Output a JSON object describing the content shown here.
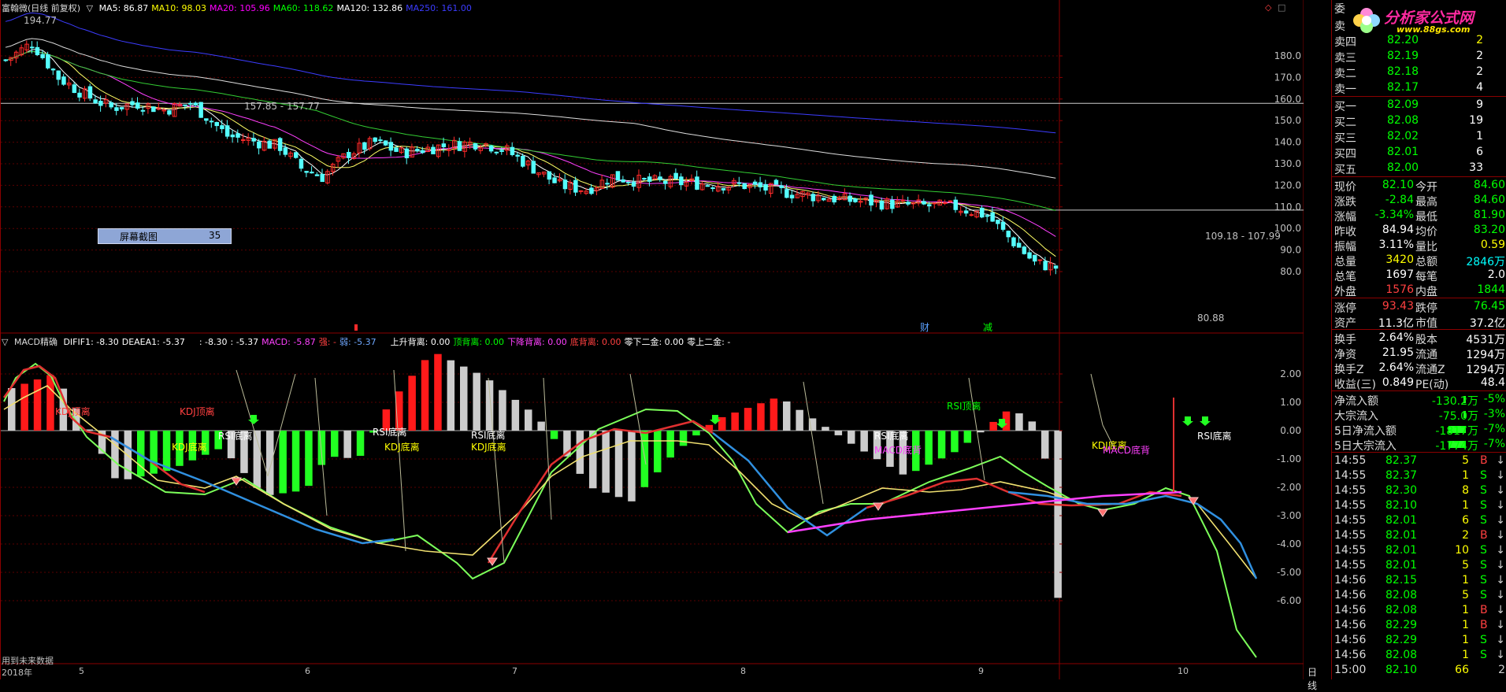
{
  "main_header": {
    "title": "富翰微(日线 前复权)",
    "ma_labels": [
      {
        "text": "MA5: 86.87",
        "color": "#ffffff"
      },
      {
        "text": "MA10: 98.03",
        "color": "#ffff00"
      },
      {
        "text": "MA20: 105.96",
        "color": "#ff00ff"
      },
      {
        "text": "MA60: 118.62",
        "color": "#00ff00"
      },
      {
        "text": "MA120: 132.86",
        "color": "#ffffff"
      },
      {
        "text": "MA250: 161.00",
        "color": "#3c3cff"
      }
    ]
  },
  "price_axis": [
    "180.0",
    "170.0",
    "160.0",
    "150.0",
    "140.0",
    "130.0",
    "120.0",
    "110.0",
    "100.0",
    "90.0",
    "80.0"
  ],
  "price_annotations": {
    "high": "194.77",
    "level1": "157.85 - 157.77",
    "level2": "109.18 - 107.99",
    "low": "80.88"
  },
  "event_markers": [
    {
      "text": "财",
      "color": "#5aa0ff"
    },
    {
      "text": "减",
      "color": "#00ff00"
    }
  ],
  "screenshot_badge": {
    "label": "屏幕截图",
    "value": "35"
  },
  "macd_header": {
    "title": "MACD精确",
    "items": [
      {
        "text": "DIFIF1: -8.30",
        "color": "#ffffff"
      },
      {
        "text": "DEAEA1: -5.37",
        "color": "#ffffff"
      },
      {
        "text": ": -8.30",
        "color": "#ffffff"
      },
      {
        "text": ": -5.37",
        "color": "#ffffff"
      },
      {
        "text": "MACD: -5.87",
        "color": "#ff40ff"
      },
      {
        "text": "强: -",
        "color": "#ff4040"
      },
      {
        "text": "弱: -5.37",
        "color": "#6fa8ff"
      },
      {
        "text": "上升背离: 0.00",
        "color": "#ffffff"
      },
      {
        "text": "顶背离: 0.00",
        "color": "#00ff00"
      },
      {
        "text": "下降背离: 0.00",
        "color": "#ff40ff"
      },
      {
        "text": "底背离: 0.00",
        "color": "#ff4040"
      },
      {
        "text": "零下二金: 0.00",
        "color": "#ffffff"
      },
      {
        "text": "零上二金: -",
        "color": "#ffffff"
      }
    ]
  },
  "macd_axis": [
    "2.00",
    "1.00",
    "0.00",
    "-1.00",
    "-2.00",
    "-3.00",
    "-4.00",
    "-5.00",
    "-6.00"
  ],
  "macd_annotations": [
    {
      "text": "KDJ顶离",
      "color": "#ff4040"
    },
    {
      "text": "KDJ顶离",
      "color": "#ff4040"
    },
    {
      "text": "KDJ底离",
      "color": "#ffff00"
    },
    {
      "text": "RSI底离",
      "color": "#ffffff"
    },
    {
      "text": "RSI底离",
      "color": "#ffffff"
    },
    {
      "text": "KDJ底离",
      "color": "#ffff00"
    },
    {
      "text": "RSI底离",
      "color": "#ffffff"
    },
    {
      "text": "KDJ底离",
      "color": "#ffff00"
    },
    {
      "text": "RSI顶离",
      "color": "#00ff00"
    },
    {
      "text": "RSI底离",
      "color": "#ffffff"
    },
    {
      "text": "MACD底背",
      "color": "#ff40ff"
    },
    {
      "text": "KDJ底离",
      "color": "#ffff00"
    },
    {
      "text": "MACD底背",
      "color": "#ff40ff"
    },
    {
      "text": "RSI底离",
      "color": "#ffffff"
    }
  ],
  "footer_note": "用到未来数据",
  "x_axis": {
    "labels": [
      "2018年",
      "5",
      "6",
      "7",
      "8",
      "9",
      "10"
    ],
    "period": "日线"
  },
  "quote": {
    "sell_header": "委",
    "sell_partial": [
      {
        "label": "卖",
        "price": "",
        "vol": ""
      },
      {
        "label": "卖四",
        "price": "82.20",
        "vol": "2"
      }
    ],
    "sell": [
      {
        "label": "卖三",
        "price": "82.19",
        "vol": "2"
      },
      {
        "label": "卖二",
        "price": "82.18",
        "vol": "2"
      },
      {
        "label": "卖一",
        "price": "82.17",
        "vol": "4"
      }
    ],
    "buy": [
      {
        "label": "买一",
        "price": "82.09",
        "vol": "9"
      },
      {
        "label": "买二",
        "price": "82.08",
        "vol": "19"
      },
      {
        "label": "买三",
        "price": "82.02",
        "vol": "1"
      },
      {
        "label": "买四",
        "price": "82.01",
        "vol": "6"
      },
      {
        "label": "买五",
        "price": "82.00",
        "vol": "33"
      }
    ],
    "stats": [
      {
        "l1": "现价",
        "v1": "82.10",
        "c1": "#00ff00",
        "l2": "今开",
        "v2": "84.60",
        "c2": "#00ff00"
      },
      {
        "l1": "涨跌",
        "v1": "-2.84",
        "c1": "#00ff00",
        "l2": "最高",
        "v2": "84.60",
        "c2": "#00ff00"
      },
      {
        "l1": "涨幅",
        "v1": "-3.34%",
        "c1": "#00ff00",
        "l2": "最低",
        "v2": "81.90",
        "c2": "#00ff00"
      },
      {
        "l1": "昨收",
        "v1": "84.94",
        "c1": "#ffffff",
        "l2": "均价",
        "v2": "83.20",
        "c2": "#00ff00"
      },
      {
        "l1": "振幅",
        "v1": "3.11%",
        "c1": "#ffffff",
        "l2": "量比",
        "v2": "0.59",
        "c2": "#ffff00"
      },
      {
        "l1": "总量",
        "v1": "3420",
        "c1": "#ffff00",
        "l2": "总额",
        "v2": "2846万",
        "c2": "#00ffff"
      },
      {
        "l1": "总笔",
        "v1": "1697",
        "c1": "#ffffff",
        "l2": "每笔",
        "v2": "2.0",
        "c2": "#ffffff"
      },
      {
        "l1": "外盘",
        "v1": "1576",
        "c1": "#ff4040",
        "l2": "内盘",
        "v2": "1844",
        "c2": "#00ff00"
      }
    ],
    "limits": [
      {
        "l1": "涨停",
        "v1": "93.43",
        "c1": "#ff4040",
        "l2": "跌停",
        "v2": "76.45",
        "c2": "#00ff00"
      },
      {
        "l1": "资产",
        "v1": "11.3亿",
        "c1": "#ffffff",
        "l2": "市值",
        "v2": "37.2亿",
        "c2": "#ffffff"
      }
    ],
    "finance": [
      {
        "l1": "换手",
        "v1": "2.64%",
        "l2": "股本",
        "v2": "4531万"
      },
      {
        "l1": "净资",
        "v1": "21.95",
        "l2": "流通",
        "v2": "1294万"
      },
      {
        "l1": "换手Z",
        "v1": "2.64%",
        "l2": "流通Z",
        "v2": "1294万"
      },
      {
        "l1": "收益(三)",
        "v1": "0.849",
        "l2": "PE(动)",
        "v2": "48.4"
      }
    ],
    "flows": [
      {
        "label": "净流入额",
        "val": "-130.2万",
        "pct": "-5%"
      },
      {
        "label": "大宗流入",
        "val": "-75.0万",
        "pct": "-3%"
      },
      {
        "label": "5日净流入额",
        "val": "-1817万",
        "pct": "-7%"
      },
      {
        "label": "5日大宗流入",
        "val": "-1774万",
        "pct": "-7%"
      }
    ],
    "ticks": [
      {
        "time": "14:55",
        "price": "82.37",
        "vol": "5",
        "side": "B"
      },
      {
        "time": "14:55",
        "price": "82.37",
        "vol": "1",
        "side": "S"
      },
      {
        "time": "14:55",
        "price": "82.30",
        "vol": "8",
        "side": "S"
      },
      {
        "time": "14:55",
        "price": "82.10",
        "vol": "1",
        "side": "S"
      },
      {
        "time": "14:55",
        "price": "82.01",
        "vol": "6",
        "side": "S"
      },
      {
        "time": "14:55",
        "price": "82.01",
        "vol": "2",
        "side": "B"
      },
      {
        "time": "14:55",
        "price": "82.01",
        "vol": "10",
        "side": "S"
      },
      {
        "time": "14:55",
        "price": "82.01",
        "vol": "5",
        "side": "S"
      },
      {
        "time": "14:56",
        "price": "82.15",
        "vol": "1",
        "side": "S"
      },
      {
        "time": "14:56",
        "price": "82.08",
        "vol": "5",
        "side": "S"
      },
      {
        "time": "14:56",
        "price": "82.08",
        "vol": "1",
        "side": "B"
      },
      {
        "time": "14:56",
        "price": "82.29",
        "vol": "1",
        "side": "B"
      },
      {
        "time": "14:56",
        "price": "82.29",
        "vol": "1",
        "side": "S"
      },
      {
        "time": "14:56",
        "price": "82.08",
        "vol": "1",
        "side": "S"
      },
      {
        "time": "15:00",
        "price": "82.10",
        "vol": "66",
        "side": ""
      }
    ],
    "partial_last_row": "2"
  },
  "logo": {
    "text": "分析家公式网",
    "url": "www.88gs.com"
  },
  "colors": {
    "up": "#ff2a2a",
    "down": "#55ffff",
    "grid": "#8b0000"
  }
}
